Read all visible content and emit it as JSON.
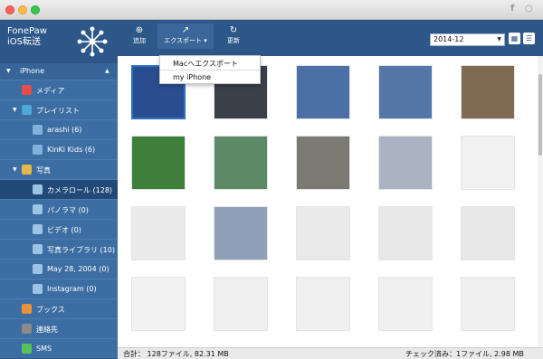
{
  "brand": {
    "line1": "FonePaw",
    "line2": "iOS転送"
  },
  "sidebar": {
    "device": "iPhone",
    "items": [
      {
        "label": "メディア",
        "color": "#e84d4d"
      },
      {
        "label": "プレイリスト",
        "color": "#4fa8d8"
      },
      {
        "label": "arashi (6)",
        "color": "#7fb2dc"
      },
      {
        "label": "KinKi Kids (6)",
        "color": "#7fb2dc"
      },
      {
        "label": "写真",
        "color": "#e6b84a"
      },
      {
        "label": "カメラロール (128)",
        "color": "#9ac3e6"
      },
      {
        "label": "パノラマ (0)",
        "color": "#9ac3e6"
      },
      {
        "label": "ビデオ (0)",
        "color": "#9ac3e6"
      },
      {
        "label": "写真ライブラリ (10)",
        "color": "#9ac3e6"
      },
      {
        "label": "May 28, 2004 (0)",
        "color": "#9ac3e6"
      },
      {
        "label": "Instagram (0)",
        "color": "#9ac3e6"
      },
      {
        "label": "ブックス",
        "color": "#e9923a"
      },
      {
        "label": "連絡先",
        "color": "#8a8a8a"
      },
      {
        "label": "SMS",
        "color": "#5ac05a"
      }
    ]
  },
  "toolbar": {
    "add": "追加",
    "export": "エクスポート",
    "refresh": "更新"
  },
  "export_menu": {
    "mac": "Macへエクスポート",
    "iphone": "my iPhone"
  },
  "date_filter": "2014-12",
  "status": {
    "total": "合計： 128ファイル, 82.31 MB",
    "checked": "チェック済み：1ファイル, 2.98 MB"
  },
  "colors": {
    "accent": "#2d5789",
    "sidebar": "#2e5b8c",
    "selected": "#224a78"
  },
  "thumbnails": [
    "#2a4d8f",
    "#3b3f48",
    "#4c6fa6",
    "#5577a8",
    "#7f6a52",
    "#3e7f3c",
    "#5d8a66",
    "#7a7a72",
    "#a9b4c0",
    "#f1f1f1",
    "#eaeaea",
    "#8fa1b8",
    "#e9e9e9",
    "#e8e8e8",
    "#e8e8e8",
    "#f2f2f2",
    "#f0f0f0",
    "#f0f0f0",
    "#f0f0f0",
    "#f0f0f0"
  ]
}
